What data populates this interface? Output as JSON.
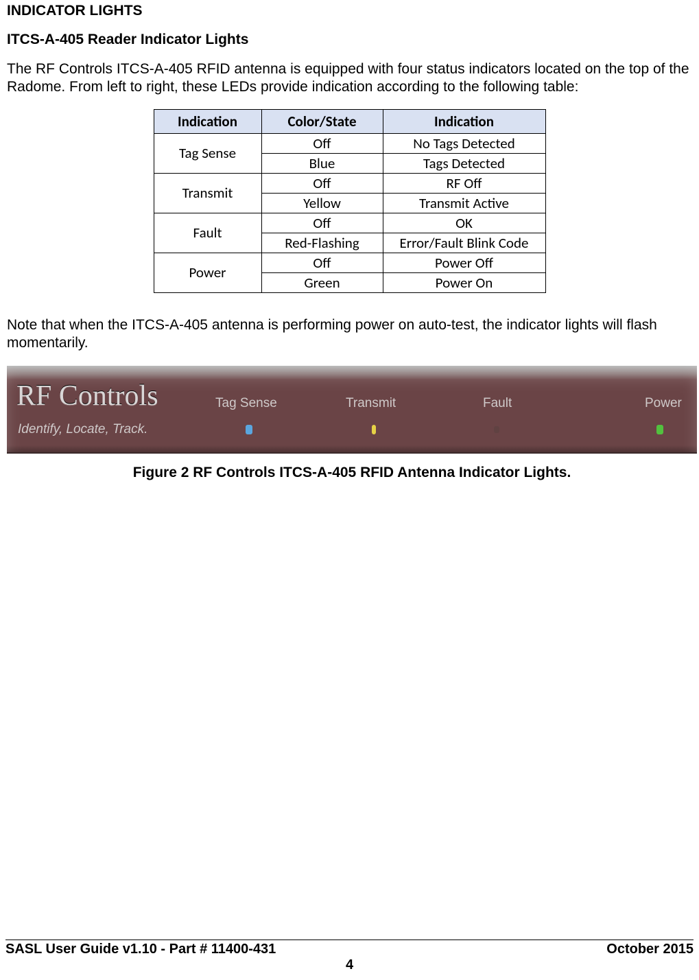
{
  "headings": {
    "section": "INDICATOR LIGHTS",
    "sub": "ITCS-A-405 Reader Indicator Lights"
  },
  "paragraphs": {
    "intro": "The RF Controls ITCS-A-405  RFID antenna is equipped with four status indicators located on the top of the Radome.  From left to right, these LEDs provide indication according to the following table:",
    "note": "Note that when the ITCS-A-405 antenna is performing power on auto-test, the indicator lights will flash momentarily."
  },
  "table": {
    "headers": {
      "c0": "Indication",
      "c1": "Color/State",
      "c2": "Indication"
    },
    "rows": [
      {
        "indicator": "Tag Sense",
        "states": [
          {
            "state": "Off",
            "meaning": "No Tags Detected"
          },
          {
            "state": "Blue",
            "meaning": "Tags Detected"
          }
        ]
      },
      {
        "indicator": "Transmit",
        "states": [
          {
            "state": "Off",
            "meaning": "RF Off"
          },
          {
            "state": "Yellow",
            "meaning": "Transmit Active"
          }
        ]
      },
      {
        "indicator": "Fault",
        "states": [
          {
            "state": "Off",
            "meaning": "OK"
          },
          {
            "state": "Red-Flashing",
            "meaning": "Error/Fault Blink Code"
          }
        ]
      },
      {
        "indicator": "Power",
        "states": [
          {
            "state": "Off",
            "meaning": "Power Off"
          },
          {
            "state": "Green",
            "meaning": "Power On"
          }
        ]
      }
    ]
  },
  "figure": {
    "brand": "RF Controls",
    "tagline": "Identify, Locate, Track.",
    "leds": {
      "tag_sense": "Tag Sense",
      "transmit": "Transmit",
      "fault": "Fault",
      "power": "Power"
    },
    "caption": "Figure 2  RF Controls ITCS-A-405 RFID Antenna Indicator Lights."
  },
  "footer": {
    "left": "SASL User Guide v1.10 - Part # 11400-431",
    "right": "October 2015",
    "page": "4"
  }
}
